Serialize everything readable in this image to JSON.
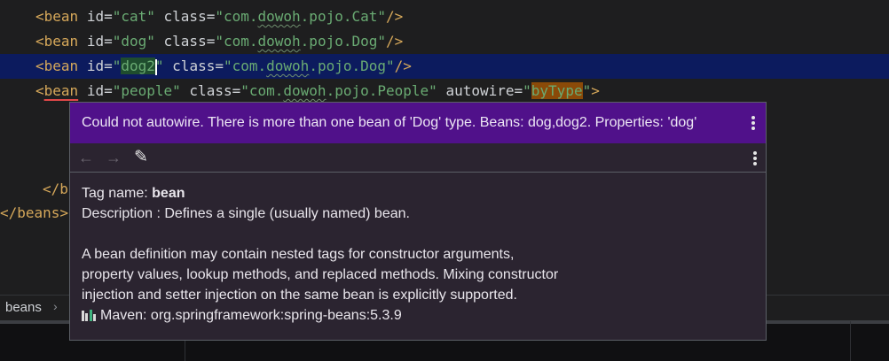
{
  "editor": {
    "line1": {
      "tag_open": "<bean",
      "id_attr": "id=",
      "id_val": "\"cat\"",
      "class_attr": "class=",
      "class_q1": "\"com.",
      "class_pkg": "dowoh",
      "class_rest": ".pojo.Cat\"",
      "tag_close": "/>"
    },
    "line2": {
      "tag_open": "<bean",
      "id_attr": "id=",
      "id_val": "\"dog\"",
      "class_attr": "class=",
      "class_q1": "\"com.",
      "class_pkg": "dowoh",
      "class_rest": ".pojo.Dog\"",
      "tag_close": "/>"
    },
    "line3": {
      "tag_open": "<bean",
      "id_attr": "id=",
      "id_q": "\"",
      "id_val": "dog2",
      "id_qe": "\"",
      "class_attr": "class=",
      "class_q1": "\"com.",
      "class_pkg": "dowoh",
      "class_rest": ".pojo.Dog\"",
      "tag_close": "/>"
    },
    "line4": {
      "lt": "<",
      "tag": "bean",
      "id_attr": "id=",
      "id_val": "\"people\"",
      "class_attr": "class=",
      "class_q1": "\"com.",
      "class_pkg": "dowoh",
      "class_rest": ".pojo.People\"",
      "autowire_attr": "autowire=",
      "aw_q1": "\"",
      "aw_val": "byType",
      "aw_q2": "\"",
      "tag_close": ">"
    },
    "line7": {
      "text": "</b"
    },
    "line8": {
      "text": "</beans>"
    }
  },
  "popup": {
    "problem_message": "Could not autowire. There is more than one bean of 'Dog' type. Beans: dog,dog2. Properties: 'dog'",
    "toolbar": {
      "back_icon": "←",
      "forward_icon": "→",
      "edit_icon": "✎"
    },
    "doc": {
      "tag_name_label": "Tag name: ",
      "tag_name_value": "bean",
      "description": "Description : Defines a single (usually named) bean.",
      "para_line1": "A bean definition may contain nested tags for constructor arguments,",
      "para_line2": "property values, lookup methods, and replaced methods. Mixing constructor",
      "para_line3": "injection and setter injection on the same bean is explicitly supported.",
      "maven": "Maven: org.springframework:spring-beans:5.3.9"
    }
  },
  "breadcrumb": {
    "item": "beans",
    "chevron": "›"
  },
  "colors": {
    "problem_bg": "#50118a",
    "popup_bg": "#2b2430",
    "highlight_line": "#0c1b5e",
    "tag": "#d6a85a",
    "string": "#6aab73"
  }
}
